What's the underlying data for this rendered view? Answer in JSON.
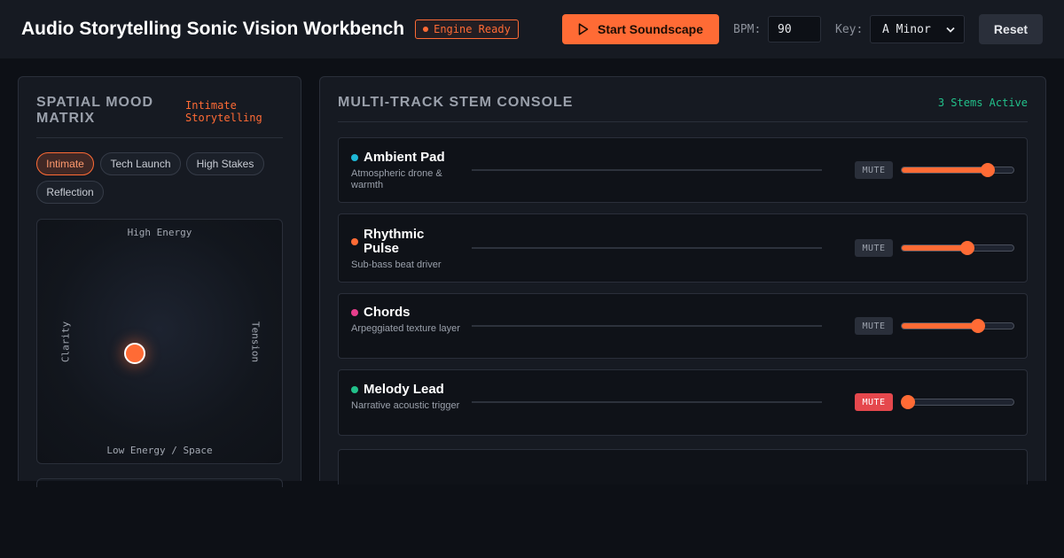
{
  "header": {
    "title": "Audio Storytelling Sonic Vision Workbench",
    "engine_status": "Engine Ready",
    "start_label": "Start Soundscape",
    "bpm_label": "BPM:",
    "bpm_value": "90",
    "key_label": "Key:",
    "key_value": "A Minor",
    "reset_label": "Reset"
  },
  "mood_panel": {
    "title": "Spatial Mood Matrix",
    "current_mood": "Intimate Storytelling",
    "presets": [
      "Intimate",
      "Tech Launch",
      "High Stakes",
      "Reflection"
    ],
    "active_preset": "Intimate",
    "axis_top": "High Energy",
    "axis_bottom": "Low Energy / Space",
    "axis_left": "Clarity",
    "axis_right": "Tension",
    "position_energy": 0.45,
    "position_tension": 0.4
  },
  "console": {
    "title": "Multi-Track Stem Console",
    "active_count_label": "3 Stems Active",
    "mute_label": "MUTE",
    "tracks": [
      {
        "name": "Ambient Pad",
        "description": "Atmospheric drone & warmth",
        "color": "#1eb8d6",
        "muted": false,
        "level": 0.77
      },
      {
        "name": "Rhythmic Pulse",
        "description": "Sub-bass beat driver",
        "color": "#ff6b35",
        "muted": false,
        "level": 0.59
      },
      {
        "name": "Chords",
        "description": "Arpeggiated texture layer",
        "color": "#e83e8c",
        "muted": false,
        "level": 0.68
      },
      {
        "name": "Melody Lead",
        "description": "Narrative acoustic trigger",
        "color": "#22c08a",
        "muted": true,
        "level": 0.0
      }
    ]
  },
  "colors": {
    "accent": "#ff6b35",
    "success": "#22c08a",
    "danger": "#e5484d"
  }
}
